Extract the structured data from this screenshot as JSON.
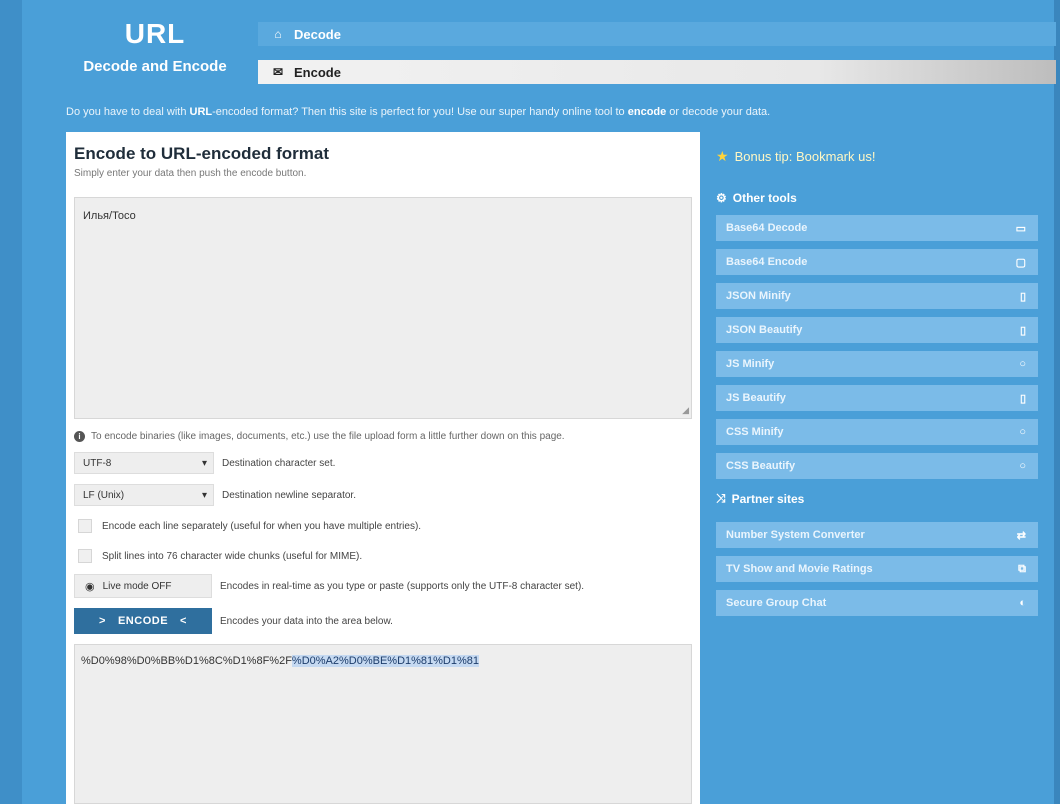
{
  "logo": {
    "title": "URL",
    "subtitle": "Decode and Encode"
  },
  "tabs": [
    {
      "label": "Decode",
      "icon": "home-icon"
    },
    {
      "label": "Encode",
      "icon": "mail-icon"
    }
  ],
  "intro": {
    "prefix": "Do you have to deal with ",
    "url_bold": "URL",
    "middle": "-encoded format? Then this site is perfect for you! Use our super handy online tool to ",
    "encode_bold": "encode",
    "suffix": " or decode your data."
  },
  "main": {
    "title": "Encode to URL-encoded format",
    "subtitle": "Simply enter your data then push the encode button.",
    "input_value": "Илья/Тосо",
    "binary_info": "To encode binaries (like images, documents, etc.) use the file upload form a little further down on this page.",
    "charset": {
      "value": "UTF-8",
      "label": "Destination character set."
    },
    "newline": {
      "value": "LF (Unix)",
      "label": "Destination newline separator."
    },
    "check_each_line": "Encode each line separately (useful for when you have multiple entries).",
    "check_split": "Split lines into 76 character wide chunks (useful for MIME).",
    "live_mode": {
      "label": "Live mode OFF",
      "desc": "Encodes in real-time as you type or paste (supports only the UTF-8 character set)."
    },
    "encode_button": {
      "label": "ENCODE",
      "desc": "Encodes your data into the area below."
    },
    "output": {
      "plain": "%D0%98%D0%BB%D1%8C%D1%8F%2F",
      "highlighted": "%D0%A2%D0%BE%D1%81%D1%81"
    }
  },
  "sidebar": {
    "tip": "Bonus tip: Bookmark us!",
    "other_tools_title": "Other tools",
    "other_tools": [
      {
        "label": "Base64 Decode",
        "icon": "folder-icon"
      },
      {
        "label": "Base64 Encode",
        "icon": "box-icon"
      },
      {
        "label": "JSON Minify",
        "icon": "file-icon"
      },
      {
        "label": "JSON Beautify",
        "icon": "file-icon"
      },
      {
        "label": "JS Minify",
        "icon": "circle-icon"
      },
      {
        "label": "JS Beautify",
        "icon": "file-icon"
      },
      {
        "label": "CSS Minify",
        "icon": "circle-icon"
      },
      {
        "label": "CSS Beautify",
        "icon": "circle-icon"
      }
    ],
    "partner_title": "Partner sites",
    "partners": [
      {
        "label": "Number System Converter",
        "icon": "swap-icon"
      },
      {
        "label": "TV Show and Movie Ratings",
        "icon": "chart-icon"
      },
      {
        "label": "Secure Group Chat",
        "icon": "half-circle-icon"
      }
    ]
  }
}
